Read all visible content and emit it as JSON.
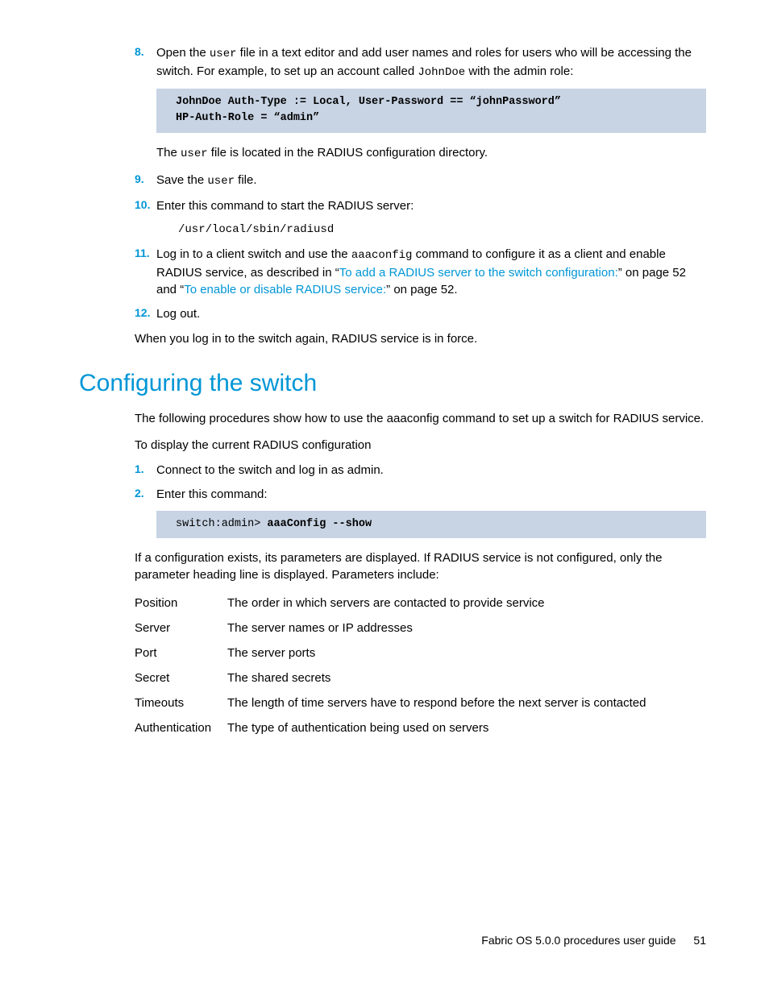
{
  "top": {
    "step8_num": "8.",
    "step8_a": "Open the ",
    "step8_b": "user",
    "step8_c": " file in a text editor and add user names and roles for users who will be accessing the switch. For example, to set up an account called ",
    "step8_d": "JohnDoe",
    "step8_e": " with the admin role:",
    "code1_l1": "JohnDoe Auth-Type := Local, User-Password == “johnPassword”",
    "code1_l2": "HP-Auth-Role = “admin”",
    "after8_a": "The ",
    "after8_b": "user",
    "after8_c": " file is located in the RADIUS configuration directory.",
    "step9_num": "9.",
    "step9_a": "Save the ",
    "step9_b": "user",
    "step9_c": " file.",
    "step10_num": "10.",
    "step10": "Enter this command to start the RADIUS server:",
    "cmd10": "/usr/local/sbin/radiusd",
    "step11_num": "11.",
    "step11_a": "Log in to a client switch and use the ",
    "step11_b": "aaaconfig",
    "step11_c": " command to configure it as a client and enable RADIUS service, as described in “",
    "step11_link1": "To add a RADIUS server to the switch configuration:",
    "step11_d": "” on page 52 and “",
    "step11_link2": "To enable or disable RADIUS service:",
    "step11_e": "” on page 52.",
    "step12_num": "12.",
    "step12": "Log out.",
    "closing": "When you log in to the switch again, RADIUS service is in force."
  },
  "section": {
    "title": "Configuring the switch",
    "intro": "The following procedures show how to use the aaaconfig command to set up a switch for RADIUS service.",
    "subintro": "To display the current RADIUS configuration",
    "s1_num": "1.",
    "s1": "Connect to the switch and log in as admin.",
    "s2_num": "2.",
    "s2": "Enter this command:",
    "code2_prompt": "switch:admin> ",
    "code2_cmd": "aaaConfig --show",
    "after": "If a configuration exists, its parameters are displayed. If RADIUS service is not configured, only the parameter heading line is displayed. Parameters include:",
    "params": [
      {
        "k": "Position",
        "v": "The order in which servers are contacted to provide service"
      },
      {
        "k": "Server",
        "v": "The server names or IP addresses"
      },
      {
        "k": "Port",
        "v": "The server ports"
      },
      {
        "k": "Secret",
        "v": "The shared secrets"
      },
      {
        "k": "Timeouts",
        "v": "The length of time servers have to respond before the next server is contacted"
      },
      {
        "k": "Authentication",
        "v": "The type of authentication being used on servers"
      }
    ]
  },
  "footer": {
    "title": "Fabric OS 5.0.0 procedures user guide",
    "page": "51"
  }
}
